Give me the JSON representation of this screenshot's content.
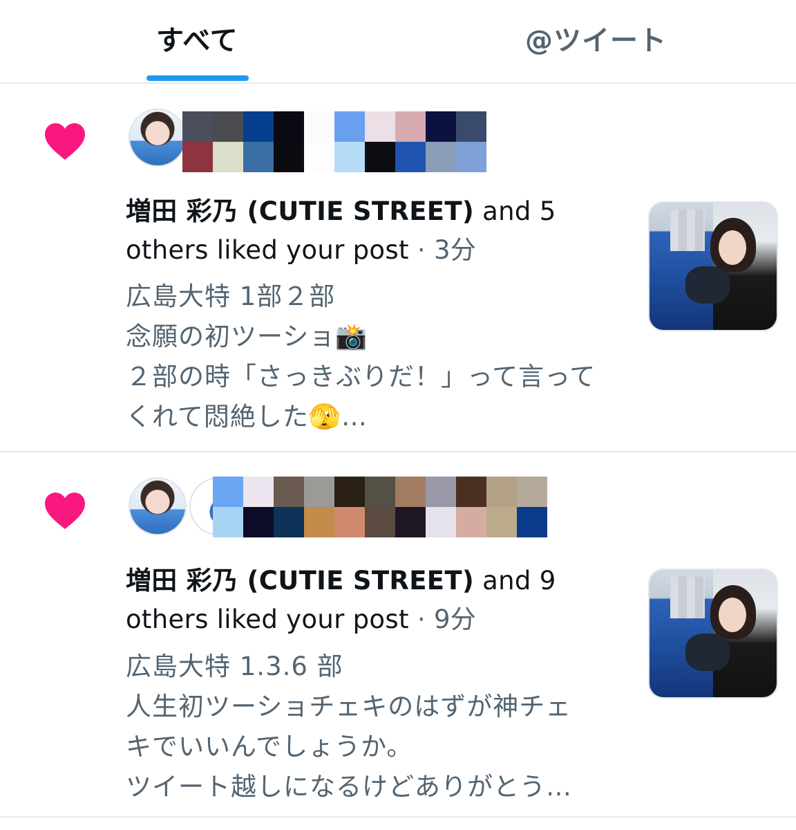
{
  "tabs": {
    "all": "すべて",
    "mentions": "@ツイート"
  },
  "colors": {
    "accent": "#1d9bf0",
    "heart": "#f91880",
    "muted": "#536471"
  },
  "notifications": [
    {
      "icon": "heart-icon",
      "name": "増田 彩乃 (CUTIE STREET)",
      "action_line1": " and 5",
      "action_line2": "others liked your post",
      "separator": " · ",
      "time": "3分",
      "snippet": [
        "広島大特 1部２部",
        "念願の初ツーショ📸",
        "２部の時「さっきぶりだ！」って言って",
        "くれて悶絶した🫣…"
      ],
      "mosaic_colors": [
        "#4a4e5c",
        "#4a4c50",
        "#053f8f",
        "#0a0a12",
        "#fbfbfd",
        "#6aa0f0",
        "#ece0e6",
        "#d8aab2",
        "#0b1240",
        "#3a4a6a",
        "#8e3440",
        "#d9dfc8",
        "#3c6ea6",
        "#0b0b12",
        "#fdfdff",
        "#b6dcf8",
        "#0d0d14",
        "#1f55b0",
        "#8a9cb6",
        "#7fa0d8"
      ]
    },
    {
      "icon": "heart-icon",
      "name": "増田 彩乃 (CUTIE STREET)",
      "action_line1": " and 9",
      "action_line2": "others liked your post",
      "separator": " · ",
      "time": "9分",
      "snippet": [
        "広島大特 1.3.6 部",
        "人生初ツーショチェキのはずが神チェ",
        "キでいいんでしょうか。",
        "ツイート越しになるけどありがとう…"
      ],
      "mosaic_colors": [
        "#6aa6f2",
        "#ece4ee",
        "#6a5a50",
        "#9a9a96",
        "#2a2014",
        "#545046",
        "#a27c62",
        "#9a98a8",
        "#4a3020",
        "#b4a286",
        "#b4aa9c",
        "#a8d4f4",
        "#0c0c28",
        "#0c3258",
        "#c48a4a",
        "#d08a6e",
        "#5a4a40",
        "#1e1620",
        "#e6e2ec",
        "#d4aca0",
        "#bcaa8c",
        "#0a3a8a"
      ]
    }
  ]
}
